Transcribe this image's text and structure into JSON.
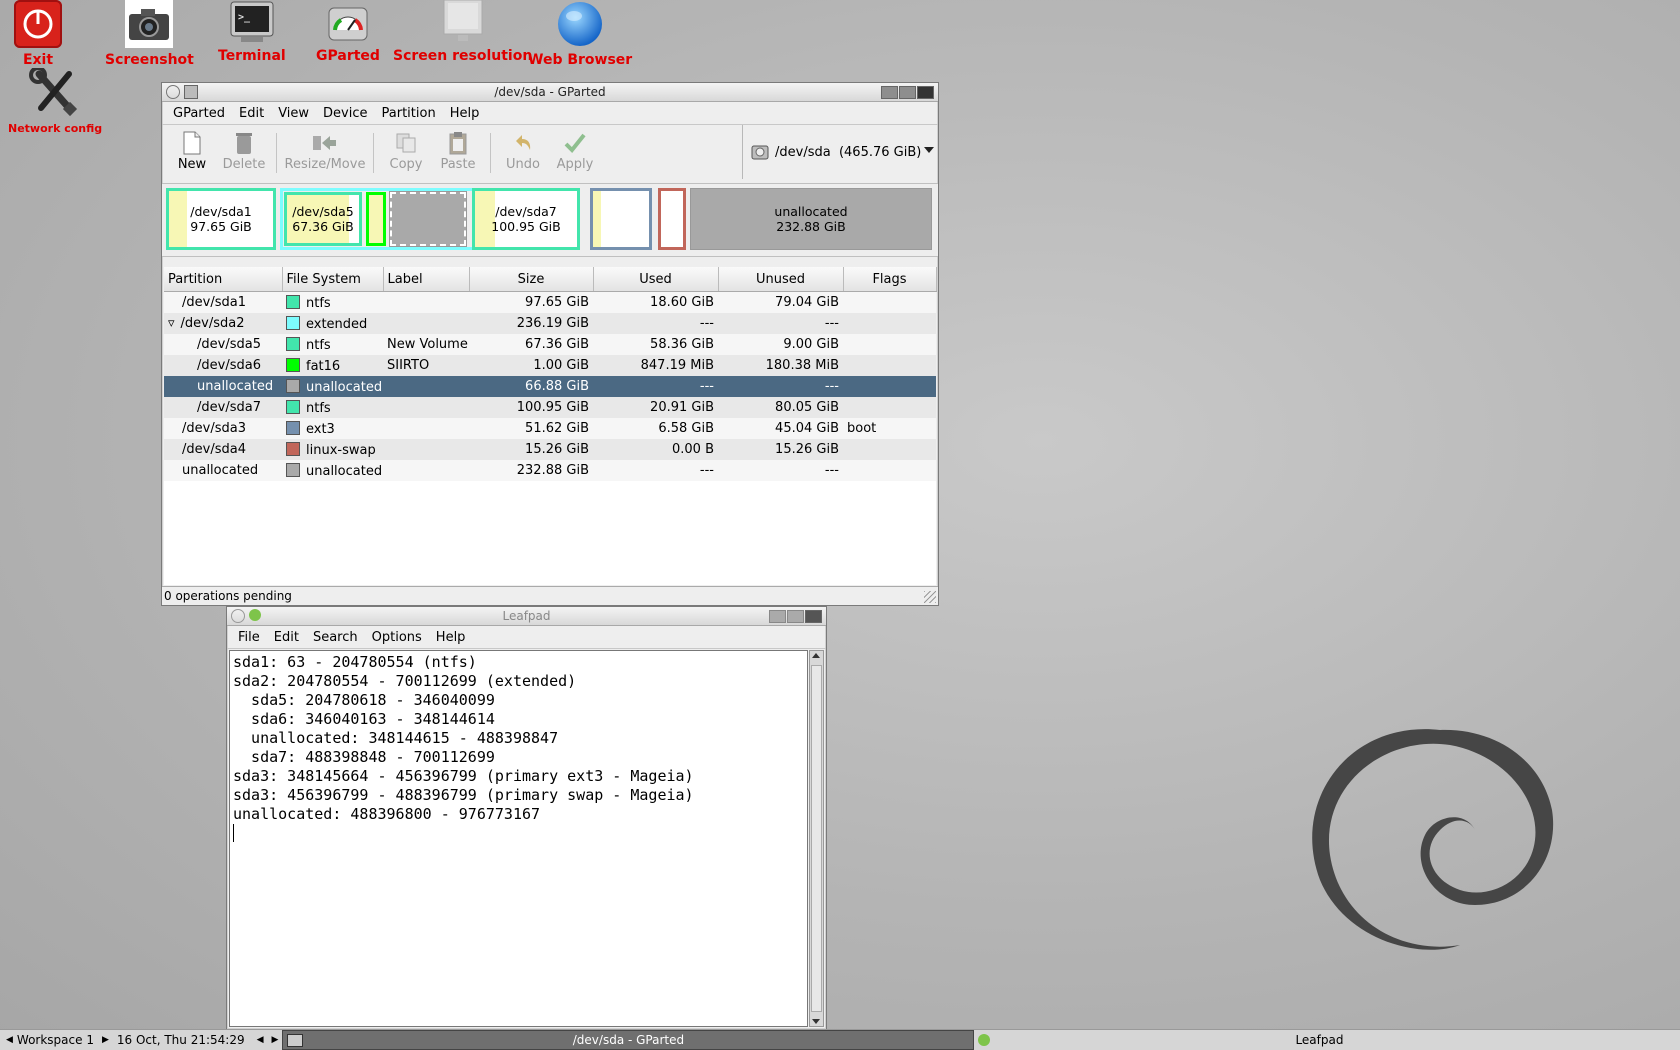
{
  "desktop": {
    "icons": [
      {
        "label": "Exit"
      },
      {
        "label": "Screenshot"
      },
      {
        "label": "Terminal"
      },
      {
        "label": "GParted"
      },
      {
        "label": "Screen resolution"
      },
      {
        "label": "Web Browser"
      },
      {
        "label": "Network config"
      }
    ]
  },
  "gparted": {
    "title": "/dev/sda - GParted",
    "menu": [
      "GParted",
      "Edit",
      "View",
      "Device",
      "Partition",
      "Help"
    ],
    "toolbar": {
      "new": "New",
      "delete": "Delete",
      "resize": "Resize/Move",
      "copy": "Copy",
      "paste": "Paste",
      "undo": "Undo",
      "apply": "Apply"
    },
    "device": "/dev/sda  (465.76 GiB)",
    "diskmap": [
      {
        "name": "/dev/sda1",
        "size": "97.65 GiB"
      },
      {
        "name": "/dev/sda5",
        "size": "67.36 GiB"
      },
      {
        "name": "/dev/sda7",
        "size": "100.95 GiB"
      },
      {
        "name": "unallocated",
        "size": "232.88 GiB"
      }
    ],
    "columns": [
      "Partition",
      "File System",
      "Label",
      "Size",
      "Used",
      "Unused",
      "Flags"
    ],
    "rows": [
      {
        "partition": "/dev/sda1",
        "fs": "ntfs",
        "color": "#42e5ac",
        "label": "",
        "size": "97.65 GiB",
        "used": "18.60 GiB",
        "unused": "79.04 GiB",
        "flags": ""
      },
      {
        "partition": "/dev/sda2",
        "fs": "extended",
        "color": "#7dfcfe",
        "label": "",
        "size": "236.19 GiB",
        "used": "---",
        "unused": "---",
        "flags": ""
      },
      {
        "partition": "/dev/sda5",
        "fs": "ntfs",
        "color": "#42e5ac",
        "label": "New Volume",
        "size": "67.36 GiB",
        "used": "58.36 GiB",
        "unused": "9.00 GiB",
        "flags": ""
      },
      {
        "partition": "/dev/sda6",
        "fs": "fat16",
        "color": "#00ff00",
        "label": "SIIRTO",
        "size": "1.00 GiB",
        "used": "847.19 MiB",
        "unused": "180.38 MiB",
        "flags": ""
      },
      {
        "partition": "unallocated",
        "fs": "unallocated",
        "color": "#a9a9a9",
        "label": "",
        "size": "66.88 GiB",
        "used": "---",
        "unused": "---",
        "flags": ""
      },
      {
        "partition": "/dev/sda7",
        "fs": "ntfs",
        "color": "#42e5ac",
        "label": "",
        "size": "100.95 GiB",
        "used": "20.91 GiB",
        "unused": "80.05 GiB",
        "flags": ""
      },
      {
        "partition": "/dev/sda3",
        "fs": "ext3",
        "color": "#7590ae",
        "label": "",
        "size": "51.62 GiB",
        "used": "6.58 GiB",
        "unused": "45.04 GiB",
        "flags": "boot"
      },
      {
        "partition": "/dev/sda4",
        "fs": "linux-swap",
        "color": "#c1665a",
        "label": "",
        "size": "15.26 GiB",
        "used": "0.00 B",
        "unused": "15.26 GiB",
        "flags": ""
      },
      {
        "partition": "unallocated",
        "fs": "unallocated",
        "color": "#a9a9a9",
        "label": "",
        "size": "232.88 GiB",
        "used": "---",
        "unused": "---",
        "flags": ""
      }
    ],
    "status": "0 operations pending"
  },
  "leafpad": {
    "title": "Leafpad",
    "menu": [
      "File",
      "Edit",
      "Search",
      "Options",
      "Help"
    ],
    "lines": [
      "sda1: 63 - 204780554 (ntfs)",
      "sda2: 204780554 - 700112699 (extended)",
      "  sda5: 204780618 - 346040099",
      "  sda6: 346040163 - 348144614",
      "  unallocated: 348144615 - 488398847",
      "  sda7: 488398848 - 700112699",
      "sda3: 348145664 - 456396799 (primary ext3 - Mageia)",
      "sda3: 456396799 - 488396799 (primary swap - Mageia)",
      "unallocated: 488396800 - 976773167"
    ]
  },
  "taskbar": {
    "workspace": "Workspace 1",
    "datetime": "16 Oct, Thu 21:54:29",
    "task1": "/dev/sda - GParted",
    "task2": "Leafpad"
  }
}
